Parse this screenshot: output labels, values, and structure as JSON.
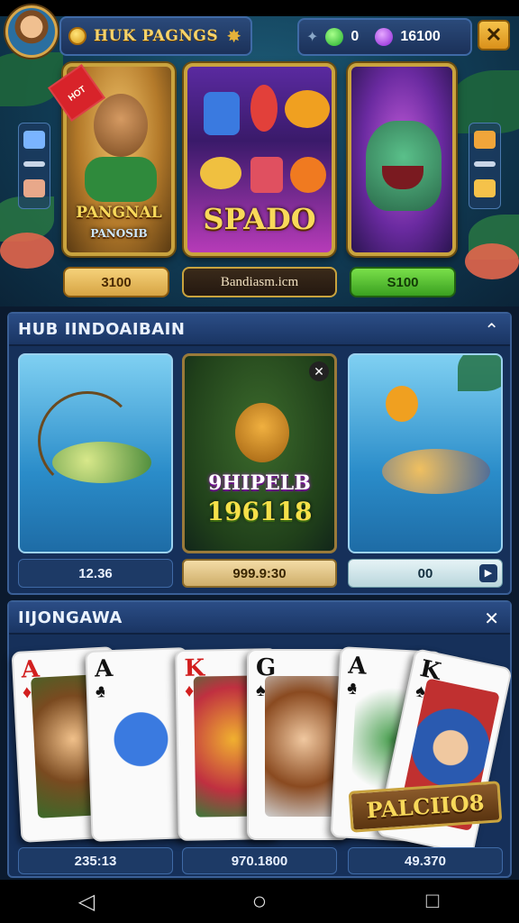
{
  "header": {
    "title": "HUK PAGNGS",
    "currency_a": "0",
    "currency_b": "16100",
    "close_label": "✕"
  },
  "featured": {
    "cards": [
      {
        "name_line1": "PANGNAL",
        "name_line2": "PANOSIB",
        "ribbon": "HOT"
      },
      {
        "name": "SPADO"
      },
      {
        "name": ""
      }
    ],
    "prices": [
      "3100",
      "Bandiasm.icm",
      "S100"
    ]
  },
  "section_hub": {
    "title": "HUB IINDOAIBAIN",
    "tile_middle_title": "9HIPELB",
    "tile_middle_number": "196118",
    "values": [
      "12.36",
      "999.9:30",
      "00"
    ]
  },
  "section_cards": {
    "title": "IIJONGAWA",
    "cards": [
      {
        "rank": "A",
        "suit": "♦",
        "color": "#d21f1f"
      },
      {
        "rank": "A",
        "suit": "♣",
        "color": "#111111"
      },
      {
        "rank": "K",
        "suit": "♦",
        "color": "#d21f1f"
      },
      {
        "rank": "G",
        "suit": "♠",
        "color": "#111111"
      },
      {
        "rank": "A",
        "suit": "♣",
        "color": "#111111"
      },
      {
        "rank": "K",
        "suit": "♠",
        "color": "#111111"
      }
    ],
    "badge": "PALCIIO8",
    "values": [
      "235:13",
      "970.1800",
      "49.370"
    ]
  },
  "navbar": {
    "back_icon": "◁",
    "home_icon": "○",
    "recents_icon": "□"
  }
}
